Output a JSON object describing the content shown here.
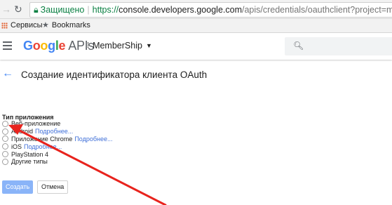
{
  "browser": {
    "secure_label": "Защищено",
    "url_scheme": "https://",
    "url_host": "console.developers.google.com",
    "url_path": "/apis/credentials/oauthclient?project=membership-"
  },
  "bookmarks": {
    "items": [
      {
        "label": "Сервисы",
        "icon": "apps-grid-icon"
      },
      {
        "label": "Bookmarks",
        "icon": "star-icon"
      }
    ]
  },
  "header": {
    "logo_google": [
      "G",
      "o",
      "o",
      "g",
      "l",
      "e"
    ],
    "logo_apis": "APIs",
    "project_name": "MemberShip",
    "search_placeholder": ""
  },
  "page": {
    "title": "Создание идентификатора клиента OAuth"
  },
  "form": {
    "section_label": "Тип приложения",
    "options": [
      {
        "label": "Веб-приложение",
        "link": ""
      },
      {
        "label": "Android",
        "link": "Подробнее..."
      },
      {
        "label": "Приложение Chrome",
        "link": "Подробнее..."
      },
      {
        "label": "iOS",
        "link": "Подробнее..."
      },
      {
        "label": "PlayStation 4",
        "link": ""
      },
      {
        "label": "Другие типы",
        "link": ""
      }
    ],
    "create_label": "Создать",
    "cancel_label": "Отмена"
  },
  "colors": {
    "accent": "#4285f4",
    "secure": "#0b8043",
    "annotation": "#e8231d"
  }
}
